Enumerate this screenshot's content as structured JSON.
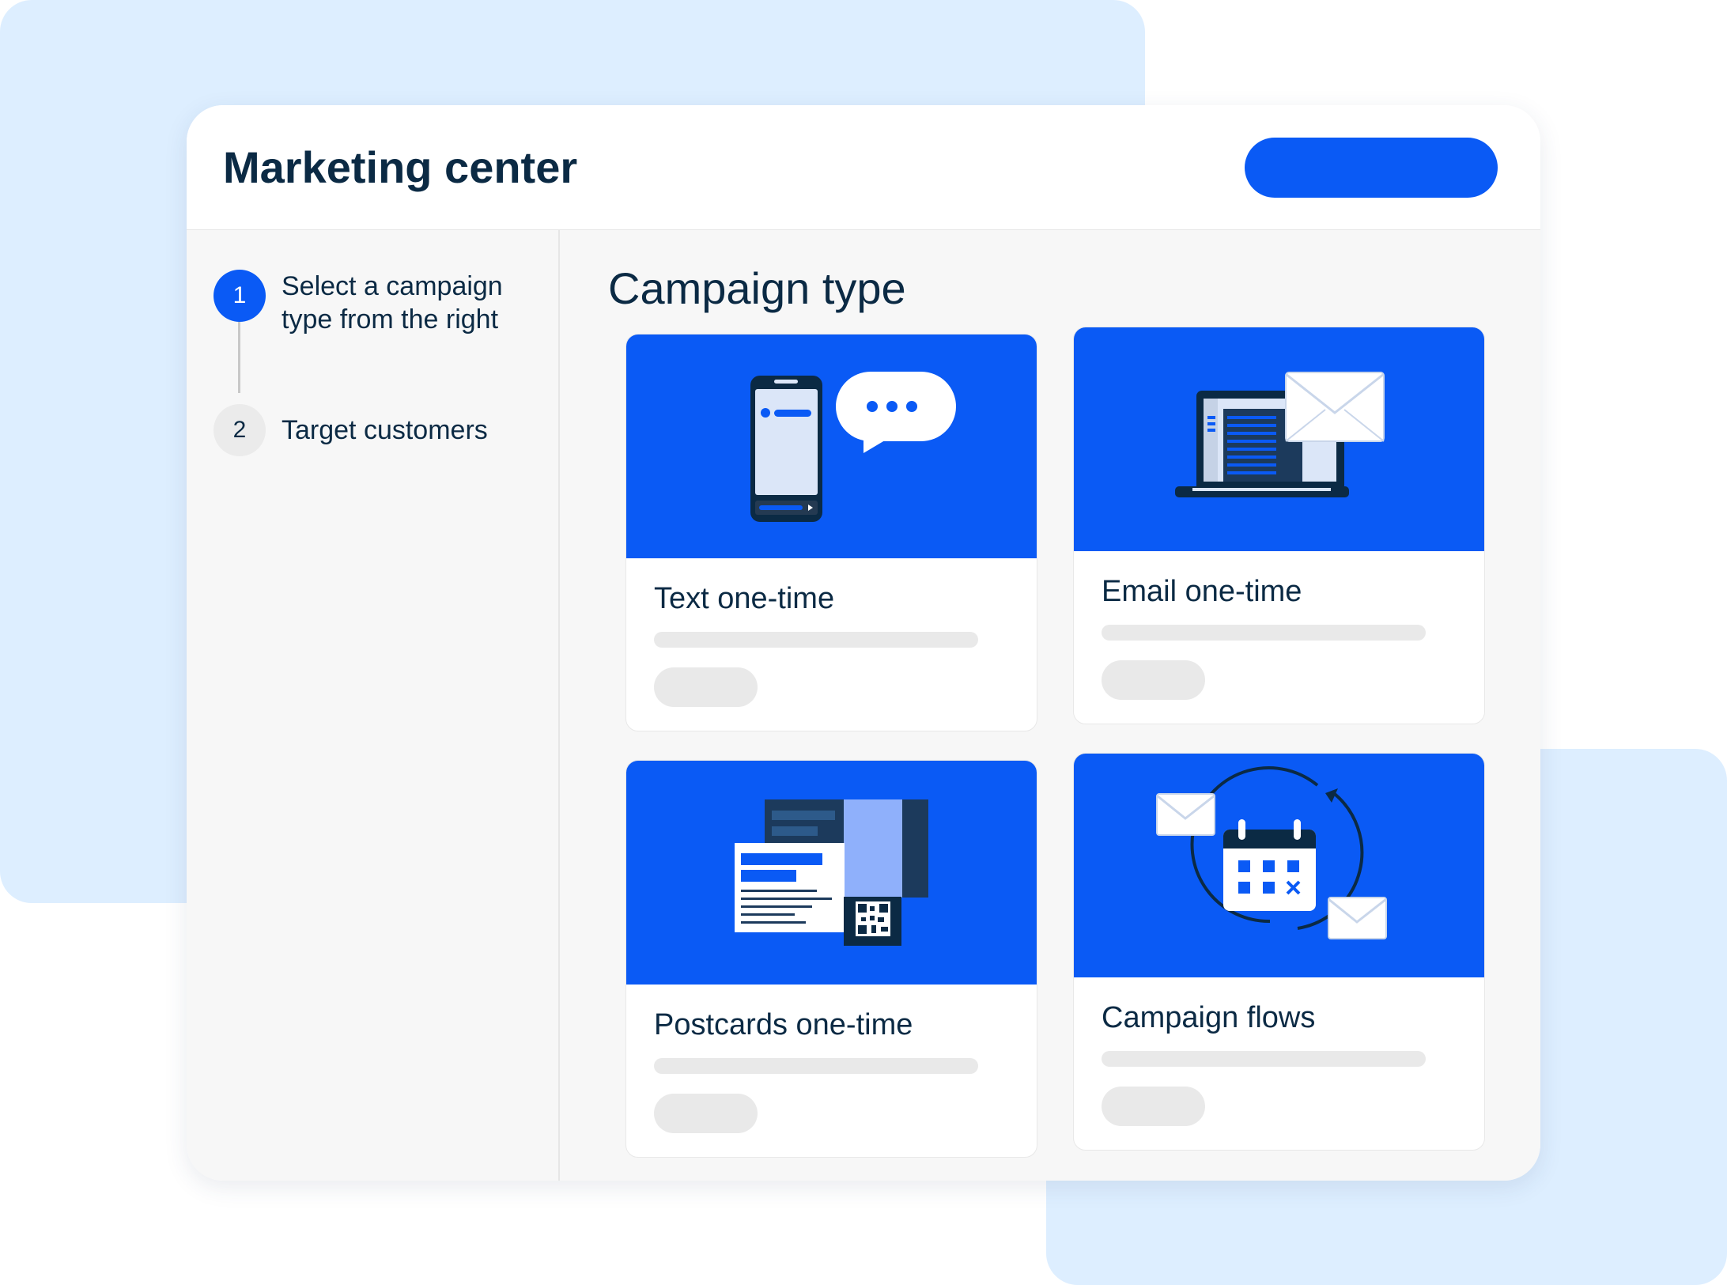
{
  "app": {
    "title": "Marketing center"
  },
  "steps": [
    {
      "number": "1",
      "label": "Select a campaign type from the right"
    },
    {
      "number": "2",
      "label": "Target customers"
    }
  ],
  "main": {
    "title": "Campaign type",
    "cards": [
      {
        "title": "Text one-time",
        "icon": "phone-chat-illustration"
      },
      {
        "title": "Email one-time",
        "icon": "laptop-email-illustration"
      },
      {
        "title": "Postcards one-time",
        "icon": "postcard-qr-illustration"
      },
      {
        "title": "Campaign flows",
        "icon": "calendar-cycle-illustration"
      }
    ]
  },
  "colors": {
    "accent": "#0a5af5",
    "text": "#0b2a44",
    "backdrop": "#ddeeff",
    "placeholder": "#e9e9e9"
  }
}
